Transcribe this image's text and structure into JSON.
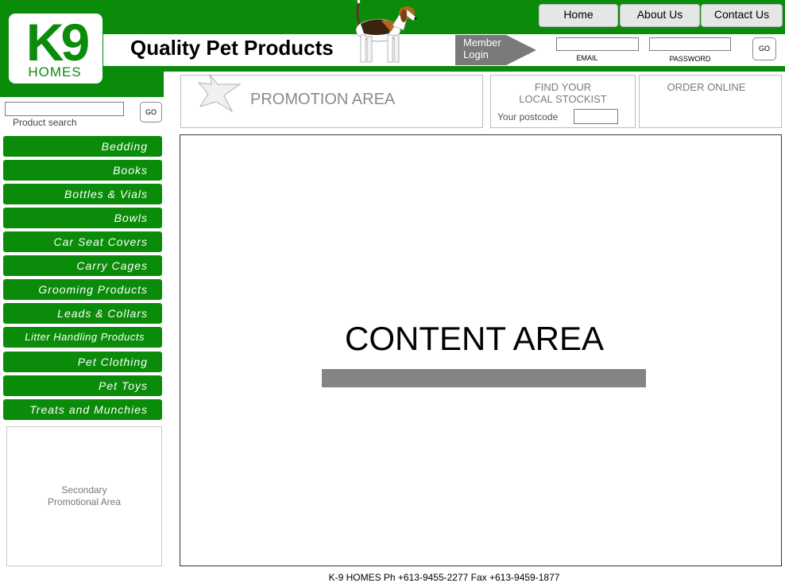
{
  "header": {
    "logo": {
      "brand": "K9",
      "sub": "HOMES"
    },
    "site_title": "Quality Pet Products",
    "nav": [
      {
        "label": "Home"
      },
      {
        "label": "About Us"
      },
      {
        "label": "Contact Us"
      }
    ],
    "member_login": {
      "line1": "Member",
      "line2": "Login"
    },
    "email_label": "EMAIL",
    "password_label": "PASSWORD",
    "go_label": "GO"
  },
  "sidebar": {
    "search_label": "Product search",
    "go_label": "GO",
    "categories": [
      {
        "label": "Bedding"
      },
      {
        "label": "Books"
      },
      {
        "label": "Bottles & Vials"
      },
      {
        "label": "Bowls"
      },
      {
        "label": "Car Seat Covers"
      },
      {
        "label": "Carry Cages"
      },
      {
        "label": "Grooming Products"
      },
      {
        "label": "Leads & Collars"
      },
      {
        "label": "Litter Handling Products"
      },
      {
        "label": "Pet Clothing"
      },
      {
        "label": "Pet Toys"
      },
      {
        "label": "Treats and Munchies"
      }
    ],
    "secondary_promo": {
      "line1": "Secondary",
      "line2": "Promotional Area"
    }
  },
  "panels": {
    "promotion": "PROMOTION AREA",
    "stockist": {
      "line1": "FIND YOUR",
      "line2": "LOCAL STOCKIST",
      "postcode_label": "Your postcode"
    },
    "order": "ORDER ONLINE"
  },
  "content": {
    "title": "CONTENT AREA"
  },
  "footer": {
    "text": "K-9 HOMES  Ph +613-9455-2277  Fax +613-9459-1877"
  },
  "colors": {
    "brand_green": "#0a8c0a",
    "member_grey": "#7a7a7a"
  }
}
